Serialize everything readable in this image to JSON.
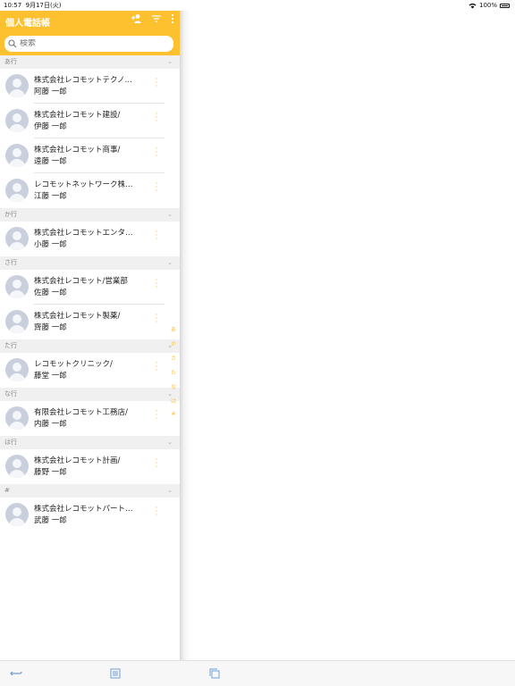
{
  "status": {
    "time": "10:57",
    "date": "9月17日(火)",
    "battery": "100%"
  },
  "header": {
    "title": "個人電話帳",
    "icons": [
      "add-person-icon",
      "filter-icon",
      "more-vertical-icon"
    ]
  },
  "search": {
    "placeholder": "検索"
  },
  "sections": [
    {
      "label": "あ行",
      "contacts": [
        {
          "company": "株式会社レコモットテクノ…",
          "name": "阿藤 一郎"
        },
        {
          "company": "株式会社レコモット建設/",
          "name": "伊藤 一郎"
        },
        {
          "company": "株式会社レコモット商事/",
          "name": "遠藤 一郎"
        },
        {
          "company": "レコモットネットワーク株…",
          "name": "江藤 一郎"
        }
      ]
    },
    {
      "label": "か行",
      "contacts": [
        {
          "company": "株式会社レコモットエンタ…",
          "name": "小藤 一郎"
        }
      ]
    },
    {
      "label": "さ行",
      "contacts": [
        {
          "company": "株式会社レコモット/営業部",
          "name": "佐藤 一郎"
        },
        {
          "company": "株式会社レコモット製薬/",
          "name": "齊藤 一郎"
        }
      ]
    },
    {
      "label": "た行",
      "contacts": [
        {
          "company": "レコモットクリニック/",
          "name": "藤堂 一郎"
        }
      ]
    },
    {
      "label": "な行",
      "contacts": [
        {
          "company": "有限会社レコモット工務店/",
          "name": "内藤 一郎"
        }
      ]
    },
    {
      "label": "は行",
      "contacts": [
        {
          "company": "株式会社レコモット計画/",
          "name": "藤野 一郎"
        }
      ]
    },
    {
      "label": "#",
      "contacts": [
        {
          "company": "株式会社レコモットパート…",
          "name": "武藤 一郎"
        }
      ]
    }
  ],
  "index": [
    "あ",
    "か",
    "さ",
    "た",
    "な",
    "は",
    "#"
  ],
  "toolbar": {
    "icons": [
      "back-arrow-icon",
      "list-icon",
      "copy-icon"
    ]
  },
  "colors": {
    "accent": "#fdc02f",
    "section_bg": "#f0f0f0",
    "avatar": "#c9cfdc"
  }
}
